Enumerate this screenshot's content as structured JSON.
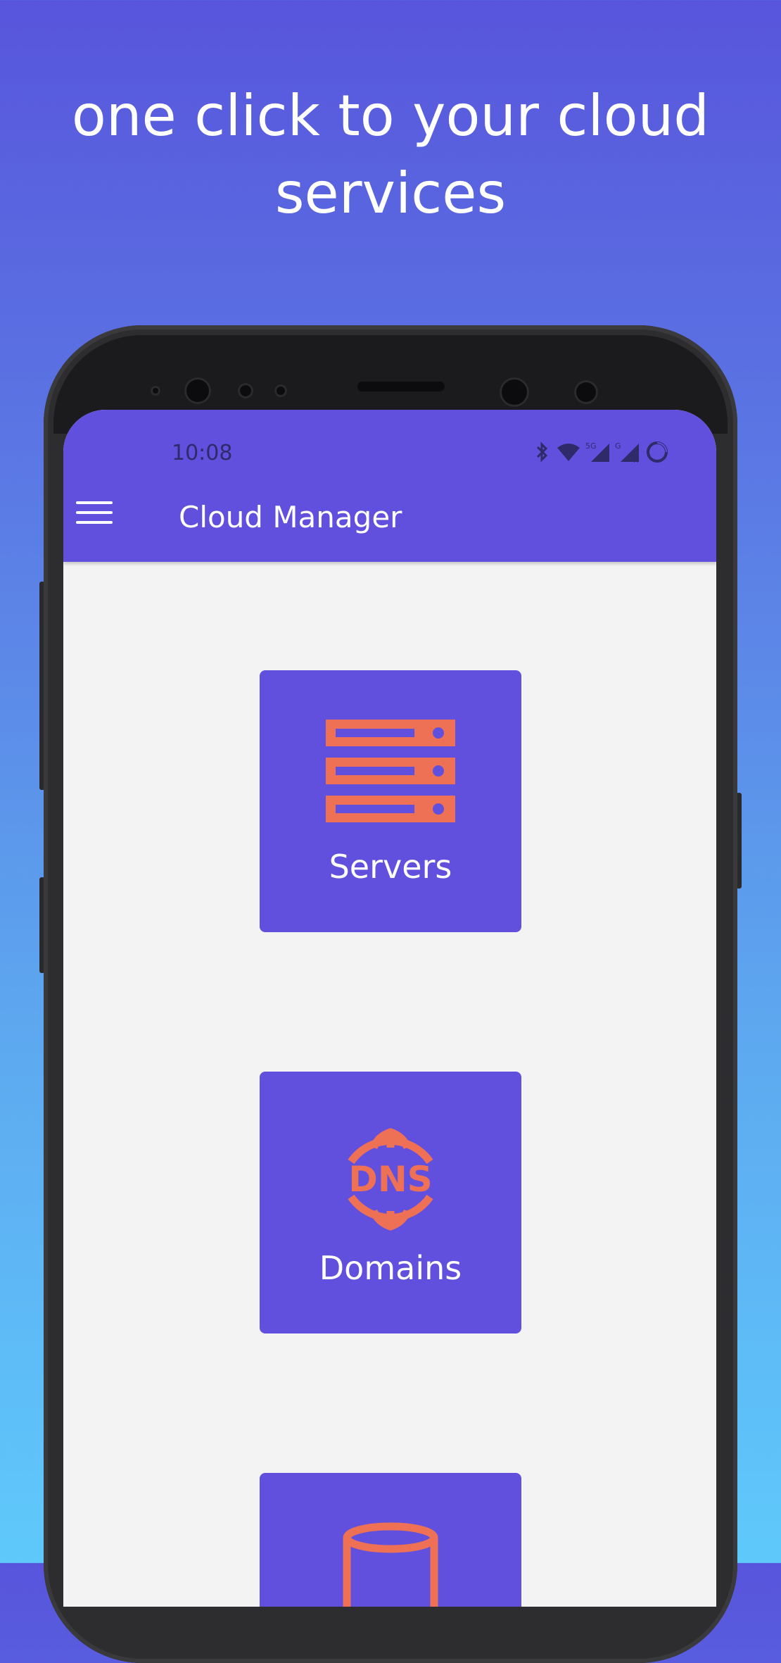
{
  "headline": "one click to your cloud\nservices",
  "status_bar": {
    "time": "10:08",
    "icons": [
      "bluetooth-icon",
      "wifi-icon",
      "signal-5g-icon",
      "signal-g-icon",
      "loading-circle-icon"
    ],
    "network_labels": [
      "5G",
      "G",
      "R"
    ]
  },
  "app_bar": {
    "title": "Cloud Manager",
    "menu_icon": "hamburger-menu-icon"
  },
  "tiles": [
    {
      "label": "Servers",
      "icon": "server-rack-icon"
    },
    {
      "label": "Domains",
      "icon": "dns-globe-icon",
      "icon_text": "DNS"
    },
    {
      "label": "",
      "icon": "database-icon"
    }
  ],
  "colors": {
    "background_top": "#5855dc",
    "background_bottom": "#5fc9fb",
    "primary": "#6150de",
    "icon_accent": "#ee7055",
    "content_background": "#f3f3f4"
  }
}
